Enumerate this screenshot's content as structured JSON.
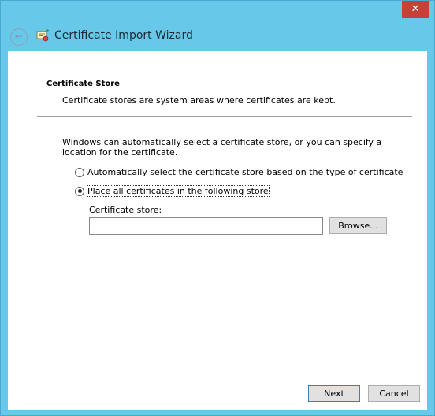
{
  "window": {
    "title": "Certificate Import Wizard",
    "close_glyph": "✕",
    "back_glyph": "←",
    "accent": "#67c8ea",
    "close_color": "#c8403a"
  },
  "page": {
    "section_title": "Certificate Store",
    "section_desc": "Certificate stores are system areas where certificates are kept.",
    "intro": "Windows can automatically select a certificate store, or you can specify a location for the certificate."
  },
  "options": {
    "auto": {
      "label": "Automatically select the certificate store based on the type of certificate",
      "selected": false
    },
    "place": {
      "label": "Place all certificates in the following store",
      "selected": true
    }
  },
  "store": {
    "label": "Certificate store:",
    "value": "",
    "browse_label": "Browse..."
  },
  "footer": {
    "next_label": "Next",
    "cancel_label": "Cancel"
  }
}
